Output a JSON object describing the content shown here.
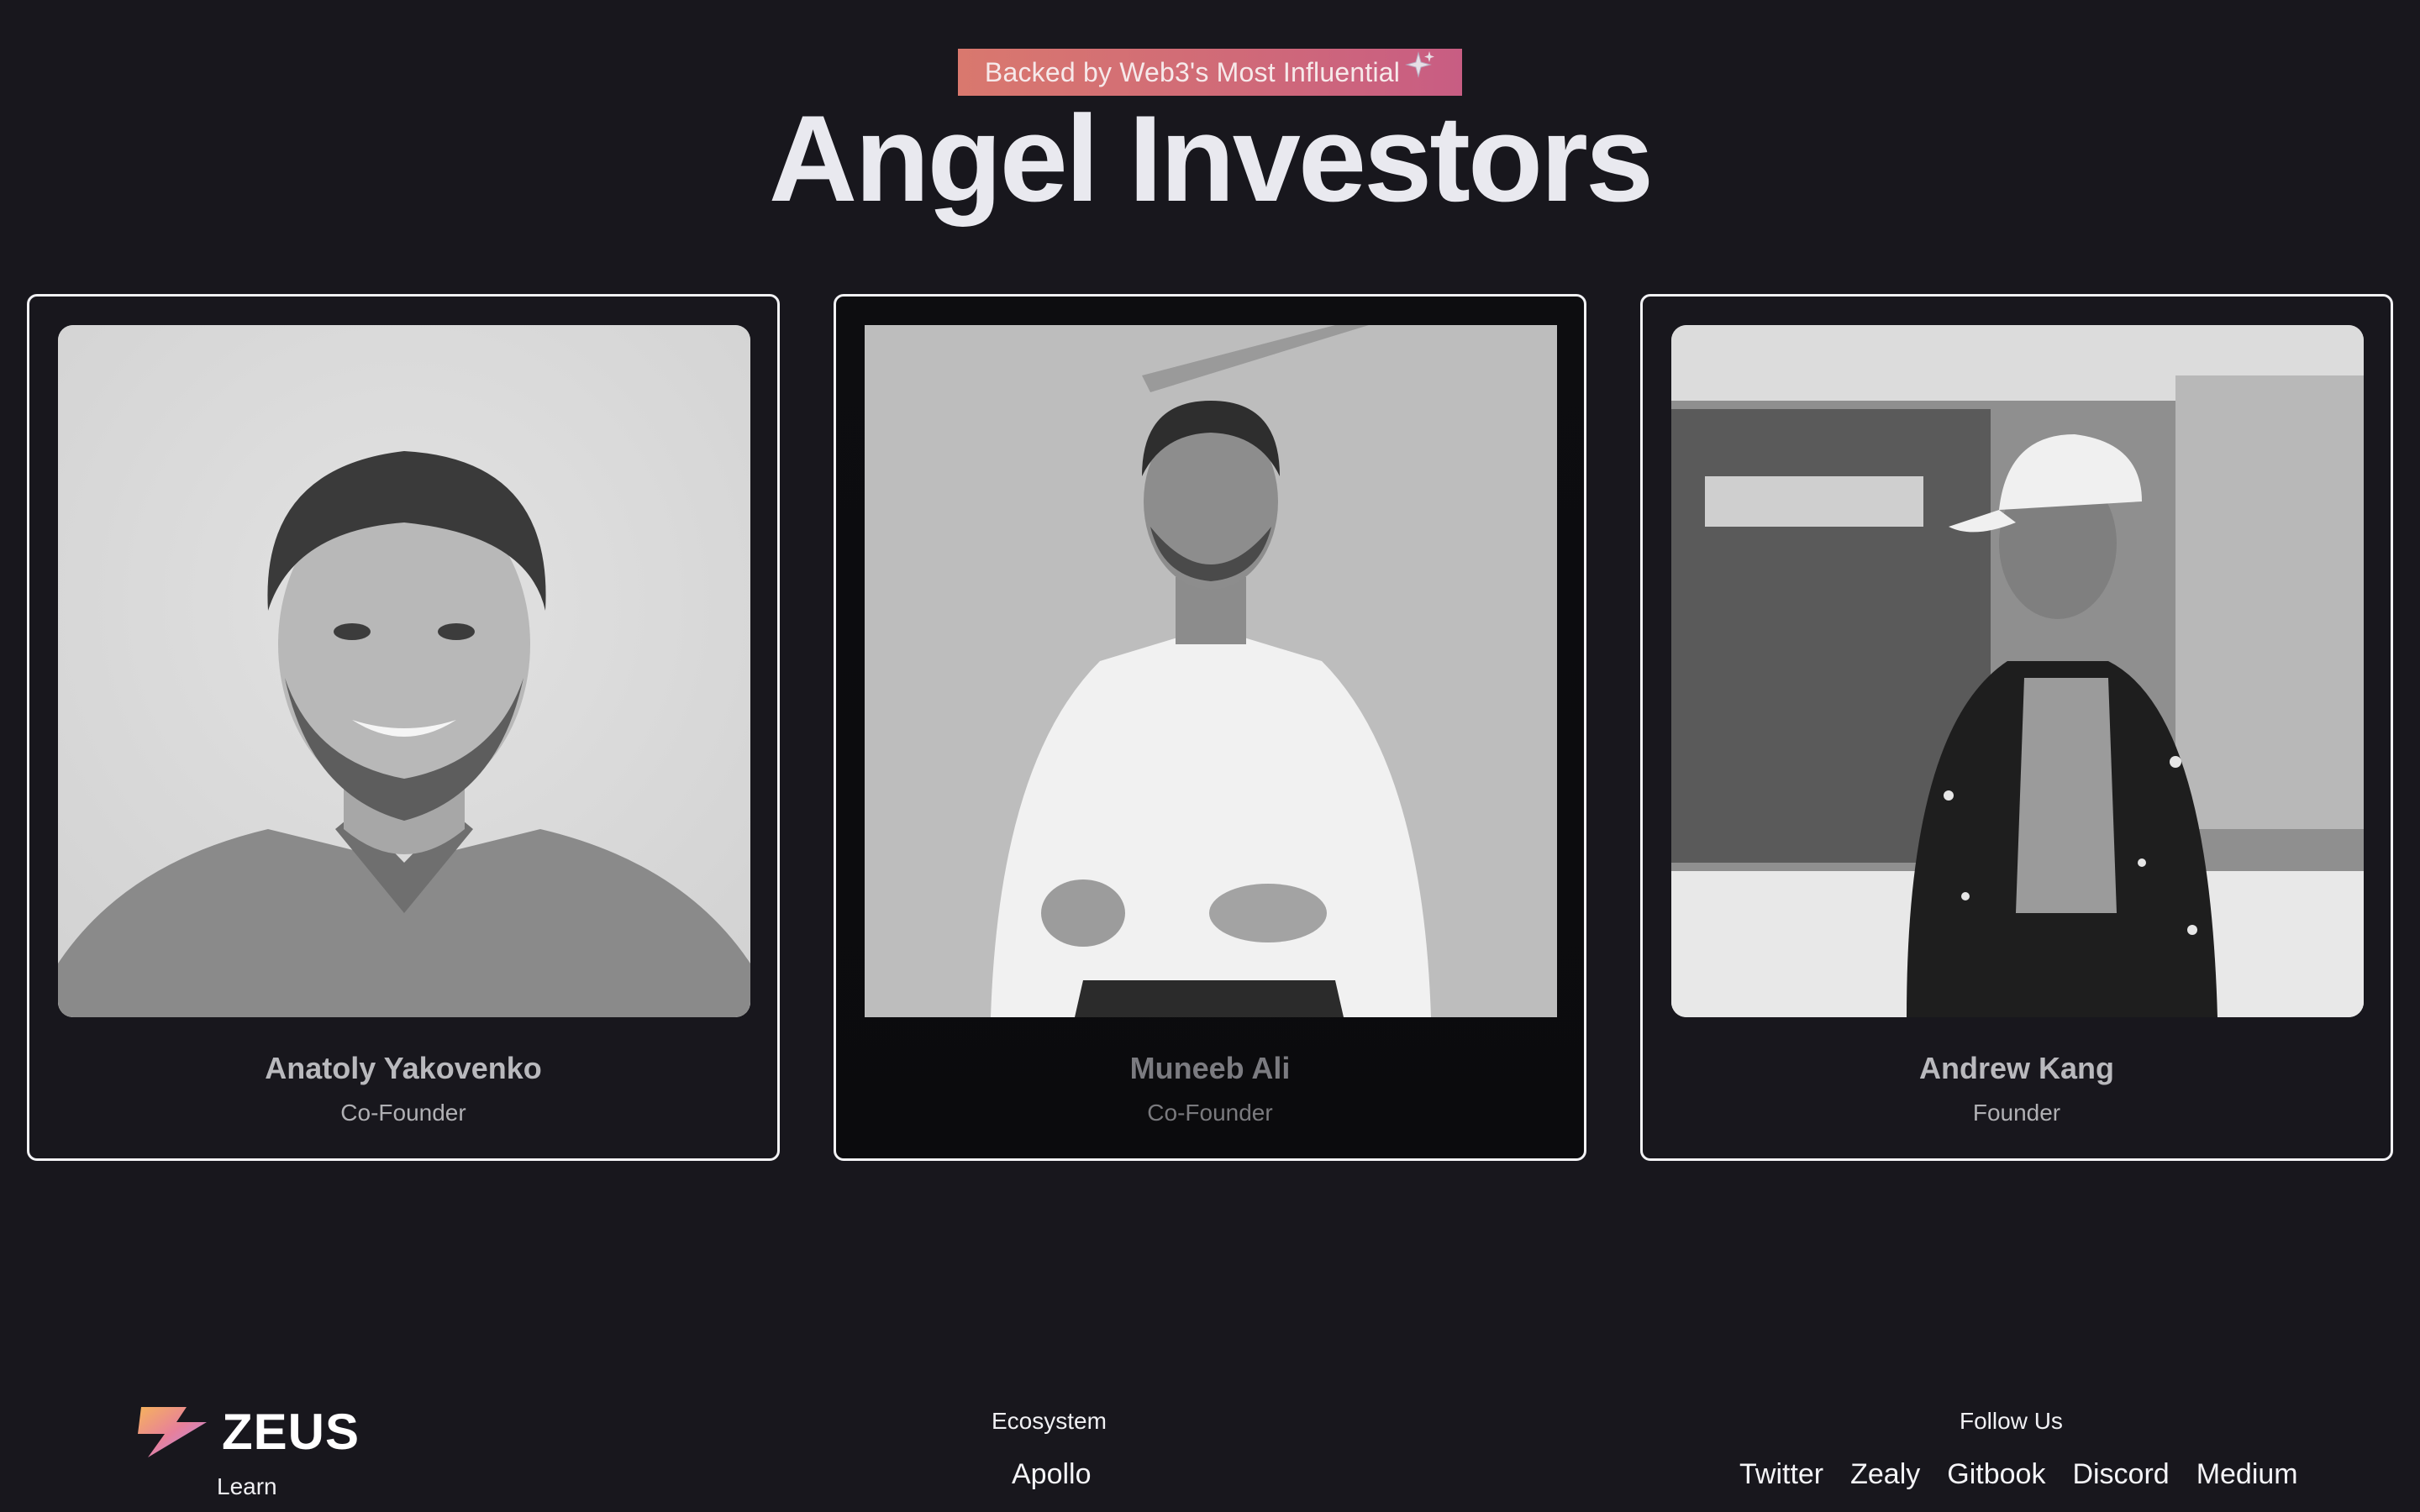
{
  "header": {
    "badge_text": "Backed by Web3's Most Influential",
    "title": "Angel Investors"
  },
  "investors": [
    {
      "name": "Anatoly Yakovenko",
      "role": "Co-Founder"
    },
    {
      "name": "Muneeb Ali",
      "role": "Co-Founder"
    },
    {
      "name": "Andrew Kang",
      "role": "Founder"
    }
  ],
  "footer": {
    "brand": "ZEUS",
    "learn": "Learn",
    "ecosystem_title": "Ecosystem",
    "ecosystem_links": [
      "Apollo"
    ],
    "follow_title": "Follow Us",
    "social_links": [
      "Twitter",
      "Zealy",
      "Gitbook",
      "Discord",
      "Medium"
    ]
  },
  "colors": {
    "background": "#18171d",
    "badge_gradient_start": "#d9786e",
    "badge_gradient_end": "#c85d83",
    "card_border": "#f2f2f5"
  },
  "icons": {
    "badge": "sparkle-icon",
    "brand": "lightning-bolt-logo"
  }
}
